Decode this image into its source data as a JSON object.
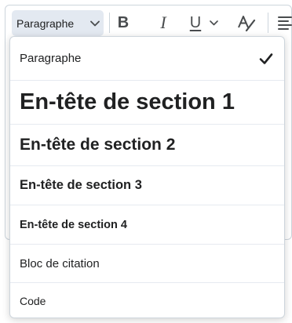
{
  "toolbar": {
    "format_select": {
      "value": "Paragraphe",
      "icon": "chevron-down-icon"
    },
    "buttons": {
      "bold": "B",
      "italic": "I",
      "underline": "U",
      "underline_menu_icon": "chevron-down-icon",
      "clear_format_icon": "clear-formatting-icon",
      "align_icon": "align-left-icon"
    }
  },
  "format_menu": {
    "items": [
      {
        "label": "Paragraphe",
        "selected": true
      },
      {
        "label": "En-tête de section 1",
        "selected": false
      },
      {
        "label": "En-tête de section 2",
        "selected": false
      },
      {
        "label": "En-tête de section 3",
        "selected": false
      },
      {
        "label": "En-tête de section 4",
        "selected": false
      },
      {
        "label": "Bloc de citation",
        "selected": false
      },
      {
        "label": "Code",
        "selected": false
      }
    ],
    "selected_icon": "checkmark-icon"
  },
  "colors": {
    "select_bg": "#e3e9f1",
    "border": "#cdd5dc",
    "text": "#202122",
    "icon": "#494c4e"
  }
}
